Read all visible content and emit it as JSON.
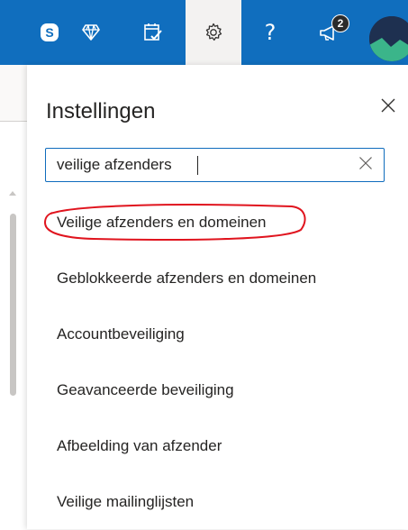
{
  "topbar": {
    "icons": [
      "skype-icon",
      "diamond-icon",
      "calendar-check-icon",
      "gear-icon",
      "help-icon",
      "feedback-icon",
      "avatar"
    ],
    "help_label": "?",
    "feedback_badge": "2",
    "brand_color": "#106ebe"
  },
  "settings": {
    "title": "Instellingen",
    "search": {
      "value": "veilige afzenders",
      "placeholder": ""
    },
    "results": [
      {
        "label": "Veilige afzenders en domeinen",
        "highlighted": true
      },
      {
        "label": "Geblokkeerde afzenders en domeinen"
      },
      {
        "label": "Accountbeveiliging"
      },
      {
        "label": "Geavanceerde beveiliging"
      },
      {
        "label": "Afbeelding van afzender"
      },
      {
        "label": "Veilige mailinglijsten"
      }
    ],
    "highlight_color": "#e0141e"
  }
}
